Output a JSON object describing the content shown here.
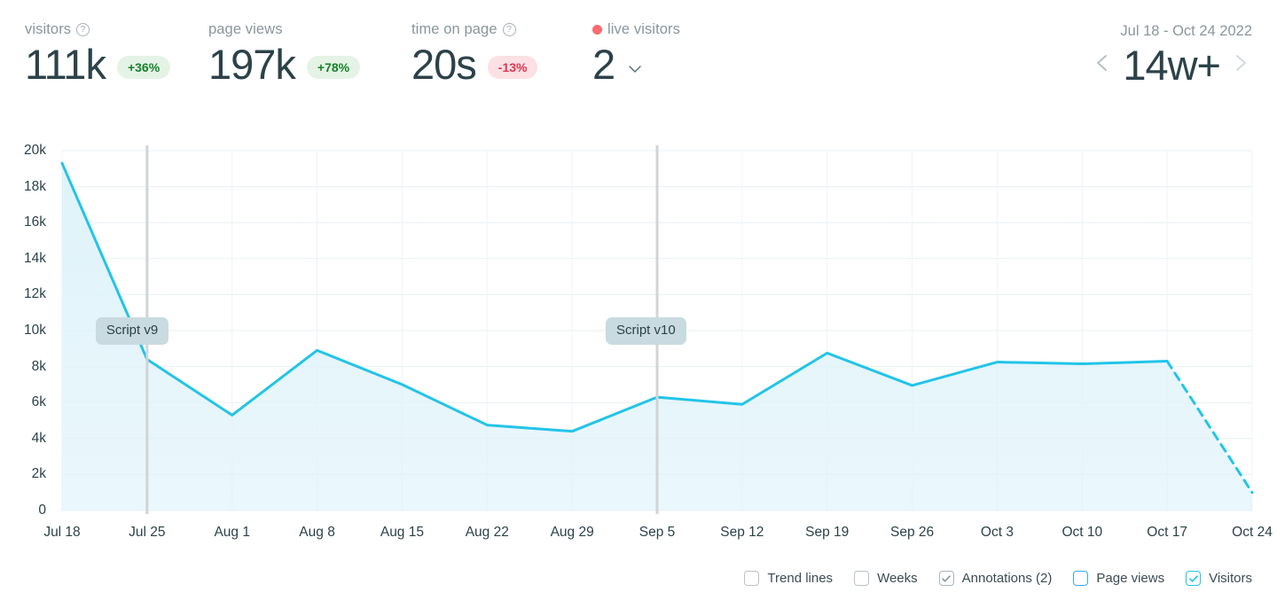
{
  "header": {
    "metrics": [
      {
        "label": "visitors",
        "has_help": true,
        "value": "111k",
        "delta": "+36%",
        "delta_dir": "pos"
      },
      {
        "label": "page views",
        "has_help": false,
        "value": "197k",
        "delta": "+78%",
        "delta_dir": "pos"
      },
      {
        "label": "time on page",
        "has_help": true,
        "value": "20s",
        "delta": "-13%",
        "delta_dir": "neg"
      },
      {
        "label": "live visitors",
        "has_help": false,
        "value": "2",
        "delta": "",
        "delta_dir": ""
      }
    ],
    "live_dot_color": "#fa6a73",
    "date_range": "Jul 18 - Oct 24 2022",
    "period": "14w+",
    "prev_label": "previous-period",
    "next_label": "next-period"
  },
  "footer": {
    "options": [
      {
        "label": "Trend lines",
        "checked": false,
        "style": "plain"
      },
      {
        "label": "Weeks",
        "checked": false,
        "style": "plain"
      },
      {
        "label": "Annotations (2)",
        "checked": true,
        "style": "gray"
      },
      {
        "label": "Page views",
        "checked": false,
        "style": "blue"
      },
      {
        "label": "Visitors",
        "checked": true,
        "style": "cyan"
      }
    ]
  },
  "chart_data": {
    "type": "area",
    "title": "",
    "xlabel": "",
    "ylabel": "",
    "grid": true,
    "legend_position": "bottom",
    "ylim": [
      0,
      20000
    ],
    "ytick_labels": [
      "20k",
      "18k",
      "16k",
      "14k",
      "12k",
      "10k",
      "8k",
      "6k",
      "4k",
      "2k",
      "0"
    ],
    "ytick_values": [
      20000,
      18000,
      16000,
      14000,
      12000,
      10000,
      8000,
      6000,
      4000,
      2000,
      0
    ],
    "categories": [
      "Jul 18",
      "Jul 25",
      "Aug 1",
      "Aug 8",
      "Aug 15",
      "Aug 22",
      "Aug 29",
      "Sep 5",
      "Sep 12",
      "Sep 19",
      "Sep 26",
      "Oct 3",
      "Oct 10",
      "Oct 17",
      "Oct 24"
    ],
    "series": [
      {
        "name": "Visitors",
        "color": "#22c4e8",
        "fill": "#dff3fa",
        "values": [
          19300,
          8400,
          5300,
          8900,
          7000,
          4750,
          4400,
          6300,
          5900,
          8750,
          6950,
          8250,
          8150,
          8300,
          1000
        ],
        "dashed_from_index": 13
      }
    ],
    "annotations": [
      {
        "label": "Script v9",
        "category": "Jul 25",
        "x_index": 1
      },
      {
        "label": "Script v10",
        "category": "Sep 5",
        "x_index": 7
      }
    ]
  }
}
